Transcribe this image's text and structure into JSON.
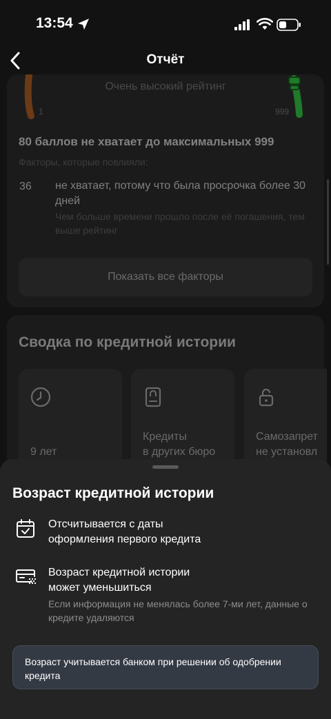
{
  "status_bar": {
    "time": "13:54"
  },
  "nav": {
    "title": "Отчёт"
  },
  "rating_card": {
    "label": "Очень высокий рейтинг",
    "scale_min": "1",
    "scale_max": "999",
    "points_title": "80 баллов не хватает до максимальных 999",
    "factors_label": "Факторы, которые повлияли:",
    "factors": [
      {
        "value": "36",
        "title": "не хватает, потому что была просрочка более 30 дней",
        "description": "Чем больше времени прошло после её погашения, тем выше рейтинг"
      }
    ],
    "show_all_label": "Показать все факторы"
  },
  "summary_card": {
    "title": "Сводка по кредитной истории",
    "tiles": [
      {
        "icon": "clock-icon",
        "line1": "",
        "line2": "9 лет"
      },
      {
        "icon": "document-icon",
        "line1": "Кредиты",
        "line2": "в других бюро"
      },
      {
        "icon": "lock-icon",
        "line1": "Самозапрет",
        "line2": "не установл"
      }
    ]
  },
  "sheet": {
    "title": "Возраст кредитной истории",
    "rows": [
      {
        "icon": "calendar-check-icon",
        "text_line1": "Отсчитывается с даты",
        "text_line2": "оформления первого кредита",
        "sub": ""
      },
      {
        "icon": "card-fading-icon",
        "text_line1": "Возраст кредитной истории",
        "text_line2": "может уменьшиться",
        "sub": "Если информация не менялась более 7-ми лет, данные о кредите удаляются"
      }
    ],
    "info": "Возраст учитывается банком при решении об одобрении кредита"
  },
  "colors": {
    "gauge_low": "#6b3a16",
    "gauge_high": "#1f7a2a",
    "sheet_bg": "#242424",
    "info_bg": "#343a44"
  }
}
